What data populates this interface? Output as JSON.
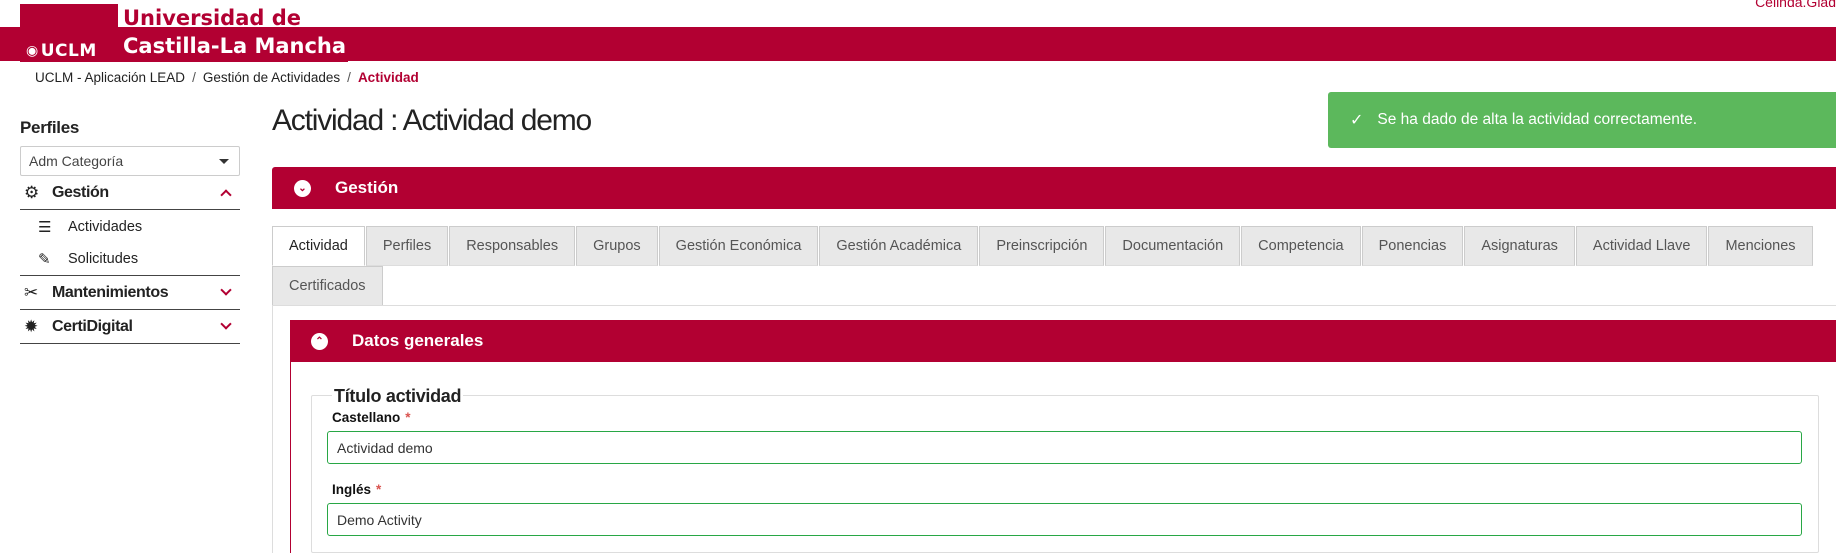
{
  "header": {
    "logo_abbr": "UCLM",
    "logo_line1": "Universidad de",
    "logo_line2": "Castilla-La Mancha",
    "user": "Celinda.Glad"
  },
  "breadcrumb": {
    "items": [
      "UCLM - Aplicación LEAD",
      "Gestión de Actividades"
    ],
    "active": "Actividad"
  },
  "sidebar": {
    "title": "Perfiles",
    "profile_selected": "Adm Categoría",
    "groups": [
      {
        "label": "Gestión",
        "icon": "gears-icon",
        "expanded": true,
        "items": [
          {
            "label": "Actividades",
            "icon": "list-check-icon"
          },
          {
            "label": "Solicitudes",
            "icon": "file-signature-icon"
          }
        ]
      },
      {
        "label": "Mantenimientos",
        "icon": "tools-icon",
        "expanded": false
      },
      {
        "label": "CertiDigital",
        "icon": "certificate-icon",
        "expanded": false
      }
    ]
  },
  "main": {
    "title": "Actividad : Actividad demo",
    "toast": "Se ha dado de alta la actividad correctamente.",
    "panel_title": "Gestión",
    "tabs": [
      "Actividad",
      "Perfiles",
      "Responsables",
      "Grupos",
      "Gestión Económica",
      "Gestión Académica",
      "Preinscripción",
      "Documentación",
      "Competencia",
      "Ponencias",
      "Asignaturas",
      "Actividad Llave",
      "Menciones",
      "Certificados"
    ],
    "active_tab": "Actividad",
    "section_title": "Datos generales",
    "fieldset_legend": "Título actividad",
    "fields": [
      {
        "label": "Castellano",
        "required_mark": "*",
        "value": "Actividad demo"
      },
      {
        "label": "Inglés",
        "required_mark": "*",
        "value": "Demo Activity"
      }
    ]
  },
  "colors": {
    "brand": "#b20032",
    "success": "#5cb85c",
    "valid_border": "#28a745"
  }
}
